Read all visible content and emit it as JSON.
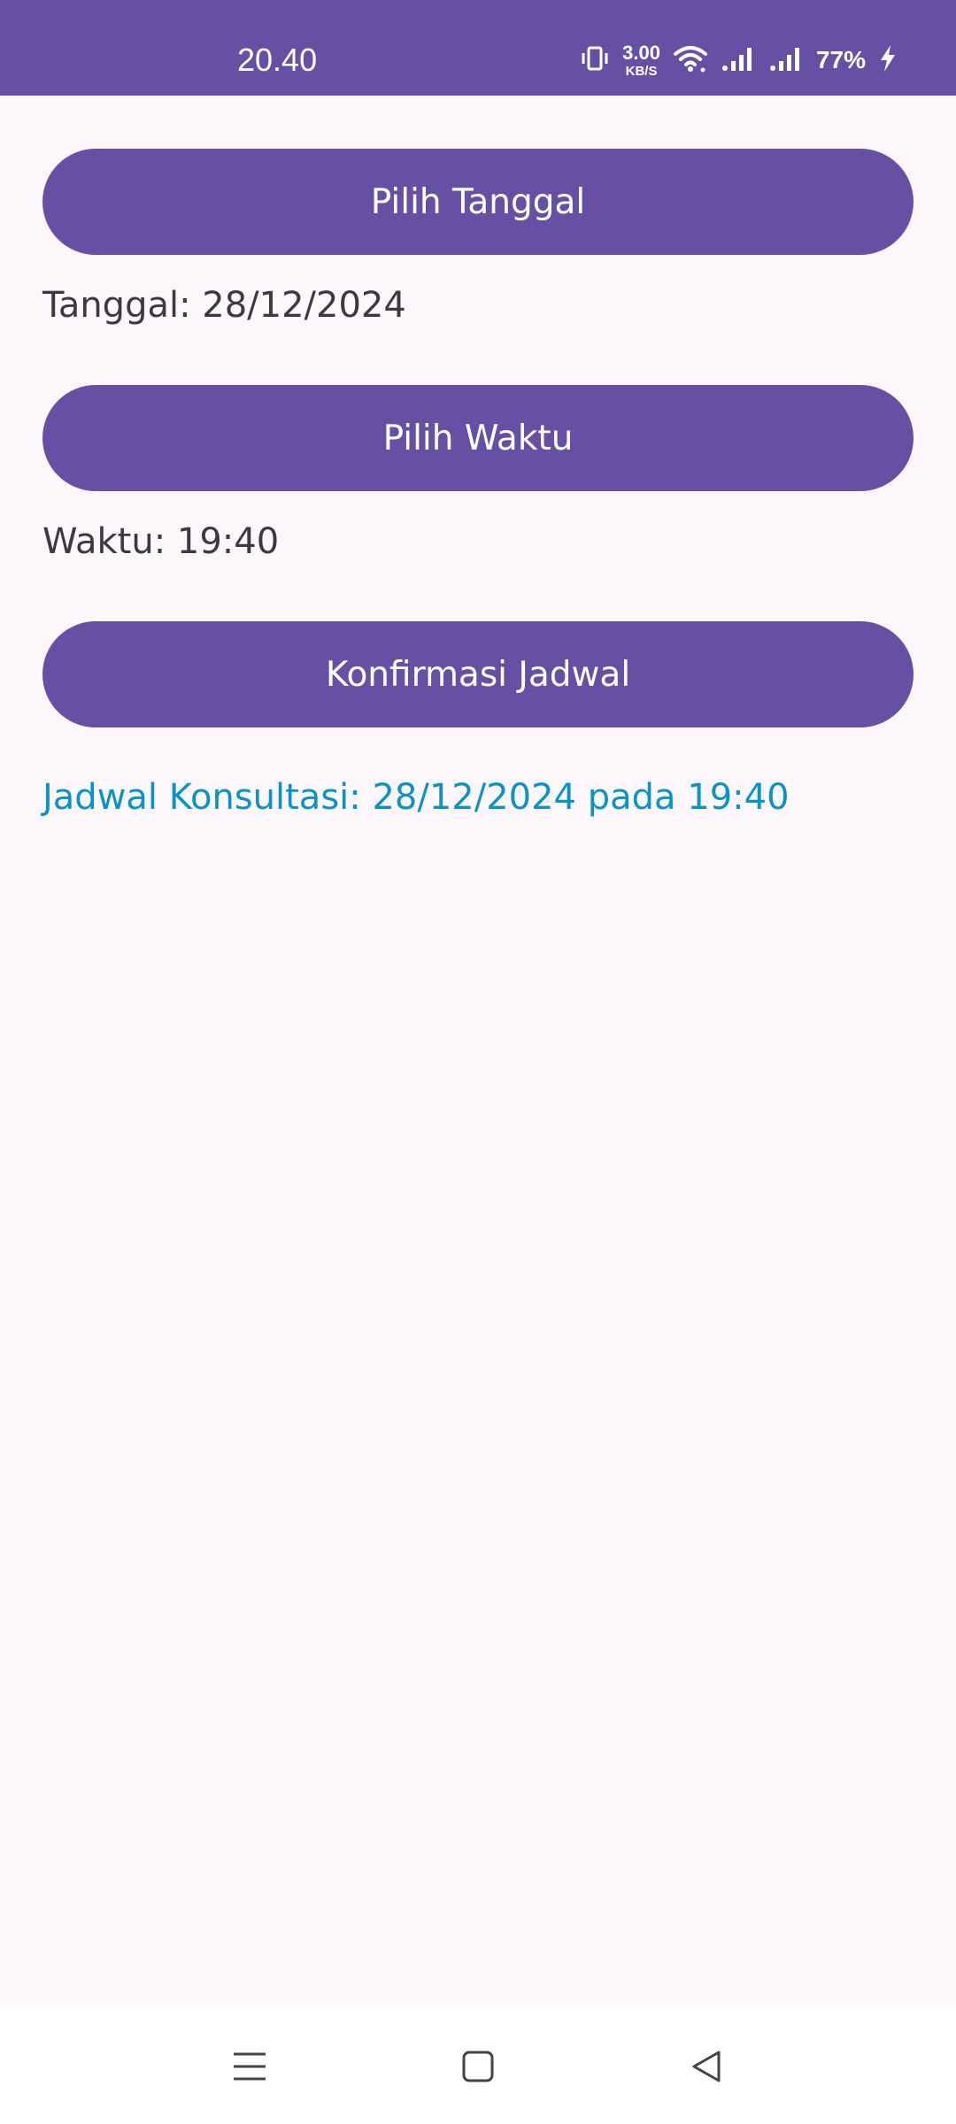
{
  "status_bar": {
    "time": "20.40",
    "net_speed_value": "3.00",
    "net_speed_unit": "KB/S",
    "battery": "77%",
    "icons": [
      "vibrate-icon",
      "wifi-icon",
      "signal-icon",
      "signal-icon",
      "charging-bolt-icon"
    ]
  },
  "main": {
    "pick_date_button": "Pilih Tanggal",
    "date_label": "Tanggal: 28/12/2024",
    "pick_time_button": "Pilih Waktu",
    "time_label": "Waktu: 19:40",
    "confirm_button": "Konfirmasi Jadwal",
    "schedule_result": "Jadwal Konsultasi: 28/12/2024 pada 19:40"
  },
  "nav_bar": {
    "icons": [
      "menu-icon",
      "home-square-icon",
      "back-triangle-icon"
    ]
  },
  "colors": {
    "primary": "#6750A4",
    "background": "#FDF7FC",
    "result_text": "#0A93C4",
    "label_text": "#3A3A3F"
  }
}
